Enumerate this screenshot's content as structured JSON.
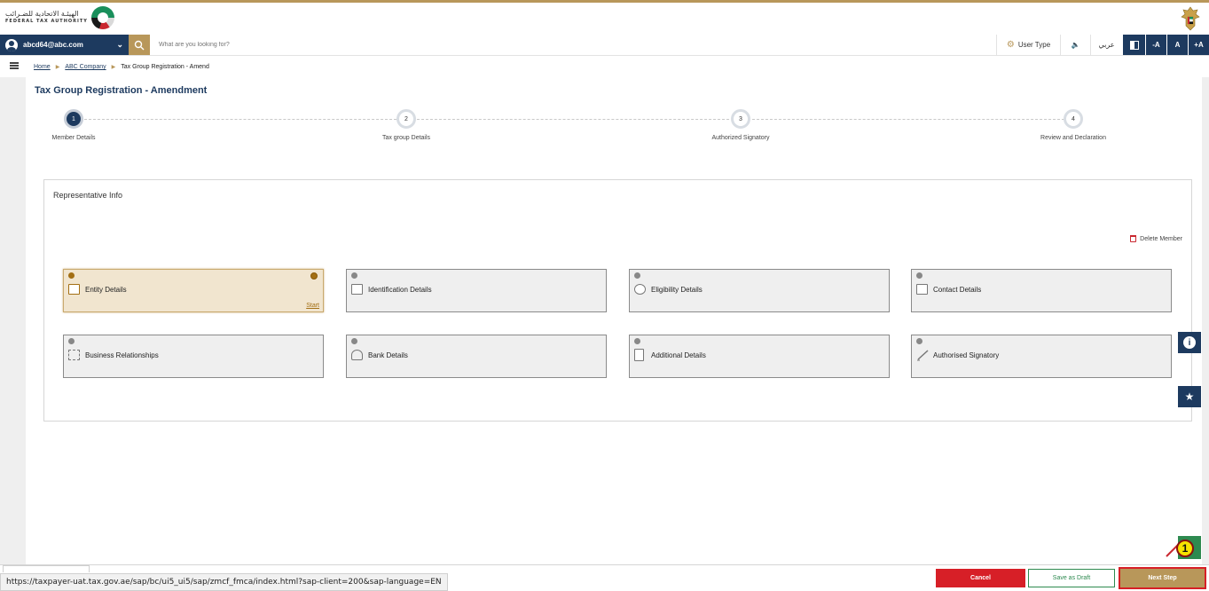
{
  "brand": {
    "arabic_name": "الهيئـة الاتحادية للضـرائب",
    "english_name": "FEDERAL TAX AUTHORITY"
  },
  "user_bar": {
    "email": "abcd64@abc.com",
    "search_placeholder": "What are you looking for?",
    "user_type_label": "User Type",
    "audio_glyph": "🔈",
    "arabic_toggle": "عربي",
    "font_minus": "-A",
    "font_normal": "A",
    "font_plus": "+A"
  },
  "breadcrumb": {
    "home": "Home",
    "company": "ABC Company",
    "current": "Tax Group Registration - Amend",
    "separator": "▶"
  },
  "page_title": "Tax Group Registration - Amendment",
  "steps": [
    {
      "number": "1",
      "label": "Member Details",
      "active": true
    },
    {
      "number": "2",
      "label": "Tax group Details",
      "active": false
    },
    {
      "number": "3",
      "label": "Authorized Signatory",
      "active": false
    },
    {
      "number": "4",
      "label": "Review and Declaration",
      "active": false
    }
  ],
  "panel": {
    "title": "Representative Info",
    "delete_member": "Delete Member"
  },
  "cards": [
    {
      "label": "Entity Details",
      "icon": "id-card-icon",
      "active": true,
      "action": "Start"
    },
    {
      "label": "Identification Details",
      "icon": "id-badge-icon",
      "active": false
    },
    {
      "label": "Eligibility Details",
      "icon": "gauge-icon",
      "active": false
    },
    {
      "label": "Contact Details",
      "icon": "contact-book-icon",
      "active": false
    },
    {
      "label": "Business Relationships",
      "icon": "org-chart-icon",
      "active": false
    },
    {
      "label": "Bank Details",
      "icon": "bank-user-icon",
      "active": false
    },
    {
      "label": "Additional Details",
      "icon": "document-icon",
      "active": false
    },
    {
      "label": "Authorised Signatory",
      "icon": "pen-icon",
      "active": false
    }
  ],
  "float_buttons": {
    "info": "i",
    "star": "★"
  },
  "footer": {
    "status_url": "https://taxpayer-uat.tax.gov.ae/sap/bc/ui5_ui5/sap/zmcf_fmca/index.html?sap-client=200&sap-language=EN",
    "cancel": "Cancel",
    "save_draft": "Save as Draft",
    "next_step": "Next Step"
  },
  "annotation": {
    "marker": "1"
  },
  "colors": {
    "navy": "#1d3a5f",
    "gold": "#b8975a",
    "red": "#d71f27",
    "green": "#2e8a50"
  }
}
